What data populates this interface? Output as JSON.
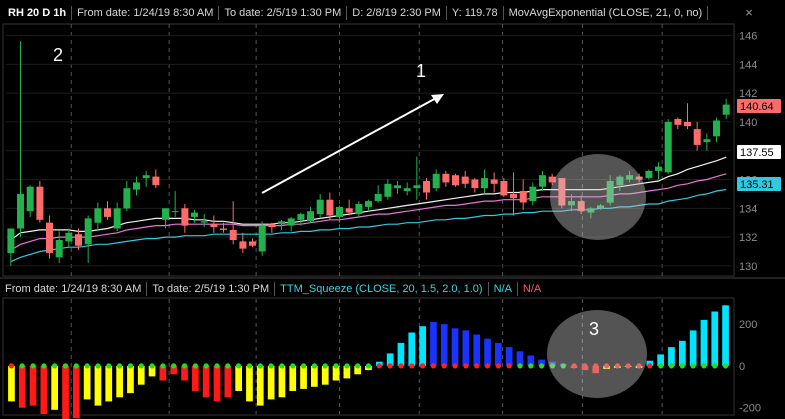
{
  "header": {
    "symbol": "RH 20 D 1h",
    "from_date": "From date: 1/24/19 8:30 AM",
    "to_date": "To date: 2/5/19 1:30 PM",
    "d_readout": "D: 2/8/19 2:30 PM",
    "y_readout": "Y: 119.78",
    "study": "MovAvgExponential (CLOSE, 21, 0, no)",
    "close_glyph": "×"
  },
  "lower_header": {
    "from_date": "From date: 1/24/19 8:30 AM",
    "to_date": "To date: 2/5/19 1:30 PM",
    "study": "TTM_Squeeze (CLOSE, 20, 1.5, 2.0, 1.0)",
    "na1": "N/A",
    "na2": "N/A"
  },
  "annotations": {
    "label1": "1",
    "label2": "2",
    "label3": "3"
  },
  "price_tags": [
    {
      "value": "140.64",
      "color": "#ff6b6b",
      "text_color": "#000000"
    },
    {
      "value": "137.55",
      "color": "#ffffff",
      "text_color": "#000000"
    },
    {
      "value": "135.31",
      "color": "#33c8e0",
      "text_color": "#000000"
    }
  ],
  "chart_data": [
    {
      "type": "candlestick",
      "ylim": [
        129.3,
        146.8
      ],
      "yticks": [
        130,
        132,
        134,
        136,
        138,
        140,
        142,
        144,
        146
      ],
      "grid": true,
      "colors": {
        "up": "#22b14c",
        "down": "#ff6b6b",
        "ema_white": "#f2f2f2",
        "ema_pink": "#e875d8",
        "ema_cyan": "#33c8e0"
      },
      "candles": [
        {
          "o": 130.9,
          "h": 132.6,
          "l": 130.0,
          "c": 132.6
        },
        {
          "o": 132.6,
          "h": 145.6,
          "l": 132.0,
          "c": 135.0
        },
        {
          "o": 133.8,
          "h": 135.6,
          "l": 133.4,
          "c": 135.5
        },
        {
          "o": 135.5,
          "h": 135.9,
          "l": 133.0,
          "c": 133.2
        },
        {
          "o": 133.0,
          "h": 133.5,
          "l": 130.5,
          "c": 130.9
        },
        {
          "o": 130.6,
          "h": 132.4,
          "l": 130.2,
          "c": 131.8
        },
        {
          "o": 131.7,
          "h": 132.6,
          "l": 131.3,
          "c": 132.3
        },
        {
          "o": 132.2,
          "h": 132.6,
          "l": 131.1,
          "c": 131.4
        },
        {
          "o": 131.5,
          "h": 133.5,
          "l": 130.2,
          "c": 133.3
        },
        {
          "o": 133.0,
          "h": 134.4,
          "l": 132.4,
          "c": 134.0
        },
        {
          "o": 134.0,
          "h": 134.5,
          "l": 133.2,
          "c": 133.4
        },
        {
          "o": 132.6,
          "h": 134.4,
          "l": 132.4,
          "c": 134.0
        },
        {
          "o": 134.0,
          "h": 135.9,
          "l": 133.8,
          "c": 135.4
        },
        {
          "o": 135.3,
          "h": 136.2,
          "l": 134.9,
          "c": 135.8
        },
        {
          "o": 136.1,
          "h": 136.6,
          "l": 135.5,
          "c": 136.3
        },
        {
          "o": 136.2,
          "h": 136.7,
          "l": 135.4,
          "c": 135.6
        },
        {
          "o": 133.2,
          "h": 134.0,
          "l": 132.6,
          "c": 134.0
        },
        {
          "o": 133.8,
          "h": 135.2,
          "l": 133.4,
          "c": 133.8
        },
        {
          "o": 134.0,
          "h": 134.3,
          "l": 132.3,
          "c": 132.8
        },
        {
          "o": 133.4,
          "h": 133.9,
          "l": 133.0,
          "c": 133.7
        },
        {
          "o": 133.0,
          "h": 133.6,
          "l": 132.7,
          "c": 133.1
        },
        {
          "o": 132.9,
          "h": 133.5,
          "l": 132.3,
          "c": 132.7
        },
        {
          "o": 132.6,
          "h": 133.0,
          "l": 132.3,
          "c": 132.5
        },
        {
          "o": 132.5,
          "h": 134.5,
          "l": 131.5,
          "c": 131.8
        },
        {
          "o": 131.7,
          "h": 132.3,
          "l": 130.9,
          "c": 131.2
        },
        {
          "o": 131.7,
          "h": 131.9,
          "l": 131.3,
          "c": 131.4
        },
        {
          "o": 131.0,
          "h": 133.1,
          "l": 130.7,
          "c": 132.8
        },
        {
          "o": 132.9,
          "h": 133.0,
          "l": 132.3,
          "c": 132.7
        },
        {
          "o": 132.9,
          "h": 133.2,
          "l": 132.5,
          "c": 133.1
        },
        {
          "o": 132.8,
          "h": 133.4,
          "l": 132.4,
          "c": 133.3
        },
        {
          "o": 133.2,
          "h": 133.7,
          "l": 132.8,
          "c": 133.6
        },
        {
          "o": 133.1,
          "h": 134.1,
          "l": 133.0,
          "c": 133.8
        },
        {
          "o": 133.6,
          "h": 135.0,
          "l": 133.3,
          "c": 134.6
        },
        {
          "o": 134.6,
          "h": 135.1,
          "l": 133.2,
          "c": 133.5
        },
        {
          "o": 133.4,
          "h": 134.2,
          "l": 133.0,
          "c": 134.1
        },
        {
          "o": 134.0,
          "h": 134.6,
          "l": 133.5,
          "c": 133.7
        },
        {
          "o": 133.6,
          "h": 134.5,
          "l": 133.4,
          "c": 134.3
        },
        {
          "o": 134.1,
          "h": 134.6,
          "l": 133.8,
          "c": 134.5
        },
        {
          "o": 134.5,
          "h": 135.6,
          "l": 134.4,
          "c": 135.0
        },
        {
          "o": 134.8,
          "h": 136.0,
          "l": 134.6,
          "c": 135.7
        },
        {
          "o": 135.4,
          "h": 135.9,
          "l": 135.0,
          "c": 135.6
        },
        {
          "o": 135.2,
          "h": 135.8,
          "l": 134.9,
          "c": 135.4
        },
        {
          "o": 135.4,
          "h": 137.6,
          "l": 134.6,
          "c": 135.6
        },
        {
          "o": 135.9,
          "h": 136.1,
          "l": 134.6,
          "c": 135.1
        },
        {
          "o": 135.4,
          "h": 136.7,
          "l": 135.2,
          "c": 136.4
        },
        {
          "o": 136.4,
          "h": 136.6,
          "l": 135.5,
          "c": 135.8
        },
        {
          "o": 136.3,
          "h": 136.4,
          "l": 135.5,
          "c": 135.6
        },
        {
          "o": 136.2,
          "h": 136.6,
          "l": 135.4,
          "c": 135.7
        },
        {
          "o": 136.0,
          "h": 136.1,
          "l": 135.1,
          "c": 135.4
        },
        {
          "o": 135.4,
          "h": 136.7,
          "l": 135.0,
          "c": 136.1
        },
        {
          "o": 136.0,
          "h": 136.5,
          "l": 135.1,
          "c": 135.7
        },
        {
          "o": 135.9,
          "h": 136.1,
          "l": 134.8,
          "c": 134.9
        },
        {
          "o": 135.0,
          "h": 136.5,
          "l": 133.5,
          "c": 134.7
        },
        {
          "o": 135.2,
          "h": 136.0,
          "l": 133.9,
          "c": 134.4
        },
        {
          "o": 134.5,
          "h": 135.8,
          "l": 134.2,
          "c": 135.5
        },
        {
          "o": 135.5,
          "h": 136.6,
          "l": 135.2,
          "c": 136.3
        },
        {
          "o": 136.2,
          "h": 136.4,
          "l": 135.6,
          "c": 135.8
        },
        {
          "o": 136.1,
          "h": 136.1,
          "l": 134.0,
          "c": 134.2
        },
        {
          "o": 134.2,
          "h": 135.0,
          "l": 133.8,
          "c": 134.5
        },
        {
          "o": 134.5,
          "h": 134.9,
          "l": 133.6,
          "c": 133.8
        },
        {
          "o": 133.7,
          "h": 134.1,
          "l": 133.3,
          "c": 134.0
        },
        {
          "o": 134.0,
          "h": 134.3,
          "l": 133.9,
          "c": 134.2
        },
        {
          "o": 134.4,
          "h": 136.3,
          "l": 134.2,
          "c": 135.9
        },
        {
          "o": 135.6,
          "h": 136.3,
          "l": 135.2,
          "c": 136.2
        },
        {
          "o": 136.0,
          "h": 136.6,
          "l": 135.8,
          "c": 136.3
        },
        {
          "o": 136.2,
          "h": 136.4,
          "l": 135.8,
          "c": 136.0
        },
        {
          "o": 136.1,
          "h": 136.7,
          "l": 136.0,
          "c": 136.6
        },
        {
          "o": 136.6,
          "h": 137.2,
          "l": 136.0,
          "c": 136.9
        },
        {
          "o": 136.5,
          "h": 140.2,
          "l": 136.4,
          "c": 140.0
        },
        {
          "o": 140.2,
          "h": 140.3,
          "l": 139.5,
          "c": 139.8
        },
        {
          "o": 140.0,
          "h": 141.3,
          "l": 139.5,
          "c": 139.7
        },
        {
          "o": 139.5,
          "h": 140.0,
          "l": 138.0,
          "c": 138.4
        },
        {
          "o": 138.6,
          "h": 139.2,
          "l": 138.0,
          "c": 138.8
        },
        {
          "o": 139.0,
          "h": 140.3,
          "l": 138.6,
          "c": 140.1
        },
        {
          "o": 140.5,
          "h": 141.6,
          "l": 140.2,
          "c": 141.2
        }
      ],
      "ema_white": [
        131.8,
        132.3,
        132.4,
        132.5,
        132.5,
        132.5,
        132.5,
        132.4,
        132.4,
        132.5,
        132.6,
        132.8,
        133.0,
        133.1,
        133.2,
        133.3,
        133.3,
        133.3,
        133.3,
        133.2,
        133.2,
        133.1,
        133.1,
        133.0,
        132.9,
        132.9,
        132.9,
        132.9,
        133.0,
        133.0,
        133.1,
        133.2,
        133.3,
        133.4,
        133.5,
        133.6,
        133.7,
        133.8,
        133.9,
        134.0,
        134.1,
        134.2,
        134.3,
        134.4,
        134.5,
        134.6,
        134.7,
        134.8,
        134.9,
        135.0,
        135.0,
        135.1,
        135.1,
        135.1,
        135.2,
        135.3,
        135.3,
        135.3,
        135.3,
        135.3,
        135.3,
        135.3,
        135.4,
        135.5,
        135.6,
        135.7,
        135.8,
        135.9,
        136.2,
        136.4,
        136.7,
        136.9,
        137.1,
        137.3,
        137.55
      ],
      "ema_pink": [
        131.1,
        131.5,
        131.7,
        131.9,
        131.9,
        132.0,
        132.0,
        132.0,
        132.0,
        132.1,
        132.2,
        132.3,
        132.5,
        132.6,
        132.7,
        132.8,
        132.8,
        132.9,
        132.9,
        132.9,
        132.9,
        132.9,
        132.9,
        132.9,
        132.8,
        132.8,
        132.8,
        132.8,
        132.8,
        132.9,
        132.9,
        133.0,
        133.1,
        133.2,
        133.2,
        133.3,
        133.4,
        133.5,
        133.6,
        133.6,
        133.7,
        133.8,
        133.9,
        134.0,
        134.1,
        134.2,
        134.2,
        134.3,
        134.4,
        134.5,
        134.5,
        134.6,
        134.6,
        134.6,
        134.7,
        134.8,
        134.8,
        134.8,
        134.8,
        134.8,
        134.8,
        134.8,
        134.9,
        135.0,
        135.0,
        135.1,
        135.2,
        135.3,
        135.4,
        135.6,
        135.7,
        135.9,
        136.0,
        136.2,
        136.4
      ],
      "ema_cyan": [
        130.3,
        130.6,
        130.8,
        131.0,
        131.1,
        131.2,
        131.3,
        131.3,
        131.4,
        131.5,
        131.5,
        131.6,
        131.7,
        131.8,
        131.9,
        131.9,
        132.0,
        132.0,
        132.1,
        132.1,
        132.1,
        132.2,
        132.2,
        132.2,
        132.2,
        132.2,
        132.2,
        132.2,
        132.3,
        132.3,
        132.4,
        132.4,
        132.5,
        132.5,
        132.6,
        132.6,
        132.7,
        132.7,
        132.8,
        132.9,
        132.9,
        133.0,
        133.0,
        133.1,
        133.2,
        133.2,
        133.3,
        133.3,
        133.4,
        133.5,
        133.5,
        133.6,
        133.6,
        133.7,
        133.7,
        133.8,
        133.8,
        133.8,
        133.9,
        133.9,
        133.9,
        134.0,
        134.0,
        134.1,
        134.1,
        134.2,
        134.3,
        134.3,
        134.5,
        134.6,
        134.7,
        134.9,
        135.0,
        135.2,
        135.31
      ]
    },
    {
      "type": "bar",
      "ylim": [
        -230,
        320
      ],
      "yticks": [
        -200,
        0,
        200
      ],
      "colors": {
        "cyan": "#00e5ff",
        "blue": "#1a33ff",
        "red": "#ff1a1a",
        "yellow": "#ffff00",
        "dot_green": "#22dd22",
        "dot_red": "#ff2020"
      },
      "values": [
        -170,
        -200,
        -190,
        -230,
        -210,
        -280,
        -250,
        -160,
        -190,
        -170,
        -150,
        -130,
        -90,
        -50,
        -70,
        -40,
        -70,
        -120,
        -150,
        -170,
        -150,
        -120,
        -170,
        -190,
        -160,
        -150,
        -120,
        -110,
        -100,
        -90,
        -70,
        -60,
        -40,
        -20,
        20,
        60,
        110,
        160,
        190,
        210,
        200,
        180,
        170,
        150,
        130,
        110,
        90,
        70,
        50,
        30,
        20,
        10,
        -10,
        -20,
        -35,
        -15,
        -10,
        -5,
        -10,
        25,
        55,
        90,
        120,
        170,
        220,
        260,
        290
      ],
      "colors_per_bar": [
        "yellow",
        "red",
        "red",
        "red",
        "yellow",
        "red",
        "red",
        "yellow",
        "yellow",
        "yellow",
        "yellow",
        "yellow",
        "yellow",
        "yellow",
        "red",
        "red",
        "red",
        "red",
        "red",
        "red",
        "red",
        "yellow",
        "yellow",
        "yellow",
        "yellow",
        "yellow",
        "yellow",
        "yellow",
        "yellow",
        "yellow",
        "yellow",
        "yellow",
        "yellow",
        "yellow",
        "cyan",
        "cyan",
        "cyan",
        "cyan",
        "cyan",
        "blue",
        "blue",
        "blue",
        "blue",
        "blue",
        "blue",
        "blue",
        "blue",
        "blue",
        "blue",
        "blue",
        "blue",
        "blue",
        "red",
        "red",
        "red",
        "yellow",
        "yellow",
        "yellow",
        "yellow",
        "cyan",
        "cyan",
        "cyan",
        "cyan",
        "cyan",
        "cyan",
        "cyan",
        "cyan"
      ],
      "squeeze_dots": [
        "red",
        "green",
        "green",
        "green",
        "green",
        "green",
        "green",
        "green",
        "green",
        "green",
        "green",
        "green",
        "green",
        "green",
        "green",
        "green",
        "green",
        "green",
        "green",
        "green",
        "green",
        "green",
        "green",
        "green",
        "green",
        "green",
        "green",
        "green",
        "green",
        "green",
        "green",
        "green",
        "green",
        "green",
        "red",
        "red",
        "red",
        "red",
        "red",
        "red",
        "red",
        "red",
        "red",
        "red",
        "red",
        "red",
        "red",
        "green",
        "green",
        "green",
        "green",
        "green",
        "red",
        "red",
        "red",
        "red",
        "red",
        "red",
        "red",
        "red",
        "green",
        "green",
        "green",
        "green",
        "green",
        "green",
        "green"
      ]
    }
  ]
}
